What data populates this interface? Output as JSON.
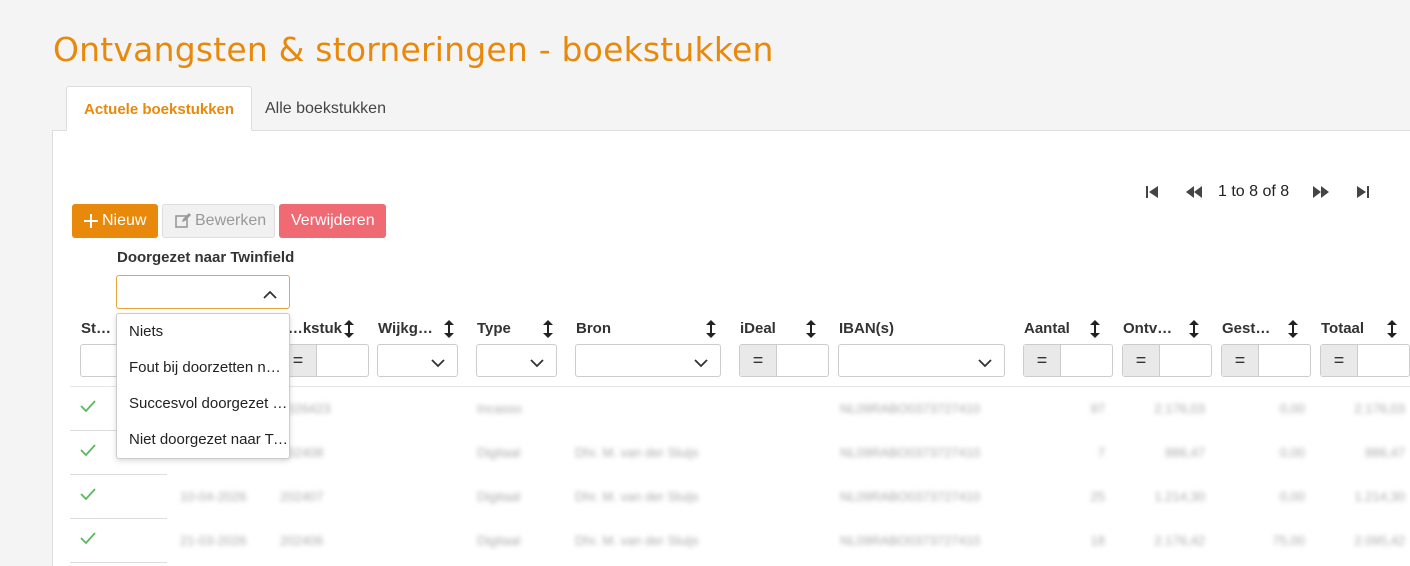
{
  "page": {
    "title": "Ontvangsten & storneringen - boekstukken"
  },
  "tabs": [
    {
      "label": "Actuele boekstukken"
    },
    {
      "label": "Alle boekstukken"
    }
  ],
  "pager": {
    "text": "1 to 8 of 8"
  },
  "toolbar": {
    "new_label": "Nieuw",
    "edit_label": "Bewerken",
    "delete_label": "Verwijderen"
  },
  "filter": {
    "label": "Doorgezet naar Twinfield",
    "value": "",
    "options": [
      "Niets",
      "Fout bij doorzetten naar Twinfield",
      "Succesvol doorgezet naar Twinfield",
      "Niet doorgezet naar Twinfield"
    ]
  },
  "columns": [
    "Status",
    "Boekstuk",
    "Wijkgebied",
    "Type",
    "Bron",
    "iDeal",
    "IBAN(s)",
    "Aantal",
    "Ontvangen",
    "Gestorneerd",
    "Totaal"
  ],
  "rows": [
    {
      "datum": "",
      "nr": "2026423",
      "type": "Incasso",
      "bron": "",
      "iban": "NL09RABO0373727410",
      "aantal": "97",
      "ontv": "2.176,03",
      "gest": "0,00",
      "tot": "2.176,03"
    },
    {
      "datum": "",
      "nr": "202408",
      "type": "Digitaal",
      "bron": "Dhr. M. van der Sluijs",
      "iban": "NL09RABO0373727410",
      "aantal": "7",
      "ontv": "886,47",
      "gest": "0,00",
      "tot": "886,47"
    },
    {
      "datum": "10-04-2026",
      "nr": "202407",
      "type": "Digitaal",
      "bron": "Dhr. M. van der Sluijs",
      "iban": "NL09RABO0373727410",
      "aantal": "25",
      "ontv": "1.214,30",
      "gest": "0,00",
      "tot": "1.214,30"
    },
    {
      "datum": "21-03-2026",
      "nr": "202406",
      "type": "Digitaal",
      "bron": "Dhr. M. van der Sluijs",
      "iban": "NL09RABO0373727410",
      "aantal": "18",
      "ontv": "2.176,42",
      "gest": "75,00",
      "tot": "2.095,42"
    }
  ],
  "colors": {
    "accent": "#e8890c",
    "danger": "#f06a74",
    "success": "#5cb85c"
  }
}
